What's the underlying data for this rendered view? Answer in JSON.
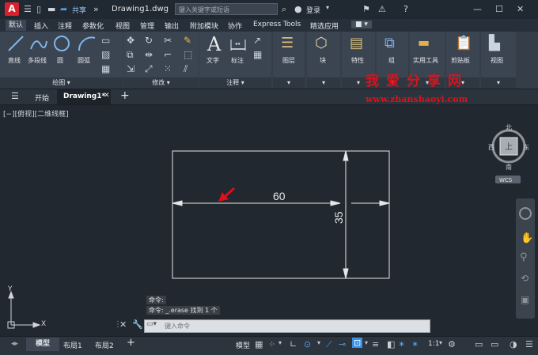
{
  "titlebar": {
    "app_logo": "A",
    "share": "共享",
    "document": "Drawing1.dwg",
    "search_placeholder": "键入关键字或短语",
    "login": "登录"
  },
  "ribbon_tabs": [
    "默认",
    "插入",
    "注释",
    "参数化",
    "视图",
    "管理",
    "输出",
    "附加模块",
    "协作",
    "Express Tools",
    "精选应用"
  ],
  "panels": {
    "draw": {
      "title": "绘图",
      "tools": [
        "直线",
        "多段线",
        "圆",
        "圆弧"
      ]
    },
    "modify": {
      "title": "修改"
    },
    "annotation": {
      "title": "注释",
      "tools": [
        "文字",
        "标注"
      ]
    },
    "layers": "图层",
    "block": "块",
    "properties": "特性",
    "groups": "组",
    "utilities": "实用工具",
    "clipboard": "剪贴板",
    "view": "视图"
  },
  "doc_tabs": {
    "start": "开始",
    "active": "Drawing1*"
  },
  "viewport": {
    "label": "[−][俯视][二维线框]"
  },
  "viewcube": {
    "north": "北",
    "south": "南",
    "west": "西",
    "east": "东",
    "top": "上",
    "wcs": "WCS"
  },
  "drawing": {
    "dim_width": "60",
    "dim_height": "35"
  },
  "ucs": {
    "x": "X",
    "y": "Y"
  },
  "command": {
    "hist1": "命令:",
    "hist2": "命令: _.erase 找到 1 个",
    "prompt": "键入命令"
  },
  "status": {
    "model_tab": "模型",
    "layout1": "布局1",
    "layout2": "布局2",
    "model_btn": "模型",
    "scale": "1:1"
  },
  "watermark": {
    "line1": "我爱分享网",
    "line2": "www.zhanshaoyi.com"
  },
  "colors": {
    "accent": "#3a8ee6",
    "watermark": "#e0101a",
    "logo": "#d4232f"
  }
}
